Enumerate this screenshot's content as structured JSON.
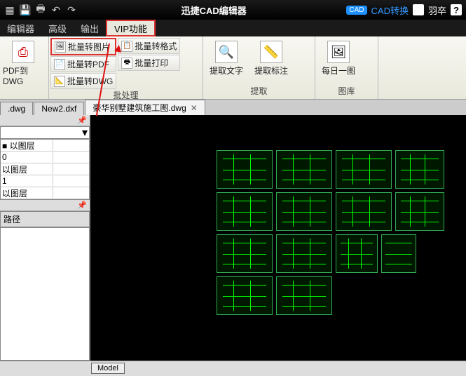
{
  "title": "迅捷CAD编辑器",
  "titlebar_right": {
    "convert": "CAD转换",
    "badge": "CAD",
    "user": "羽卒",
    "help": "?"
  },
  "menu": {
    "editor": "编辑器",
    "advanced": "高级",
    "output": "输出",
    "vip": "VIP功能"
  },
  "ribbon": {
    "g1": {
      "btn": "PDF到DWG"
    },
    "g2": {
      "toImage": "批量转图片",
      "toFormat": "批量转格式",
      "toPDF": "批量转PDF",
      "print": "批量打印",
      "toDWG": "批量转DWG",
      "label": "批处理"
    },
    "g3": {
      "text": "提取文字",
      "annot": "提取标注",
      "label": "提取"
    },
    "g4": {
      "daily": "每日一图",
      "label": "图库"
    }
  },
  "tabs": {
    "t1": ".dwg",
    "t2": "New2.dxf",
    "t3": "豪华别墅建筑施工图.dwg"
  },
  "side": {
    "rows": [
      {
        "k": "■ 以图层",
        "v": ""
      },
      {
        "k": "0",
        "v": ""
      },
      {
        "k": "以图层",
        "v": ""
      },
      {
        "k": "1",
        "v": ""
      },
      {
        "k": "以图层",
        "v": ""
      }
    ],
    "path": "路径"
  },
  "model": "Model"
}
